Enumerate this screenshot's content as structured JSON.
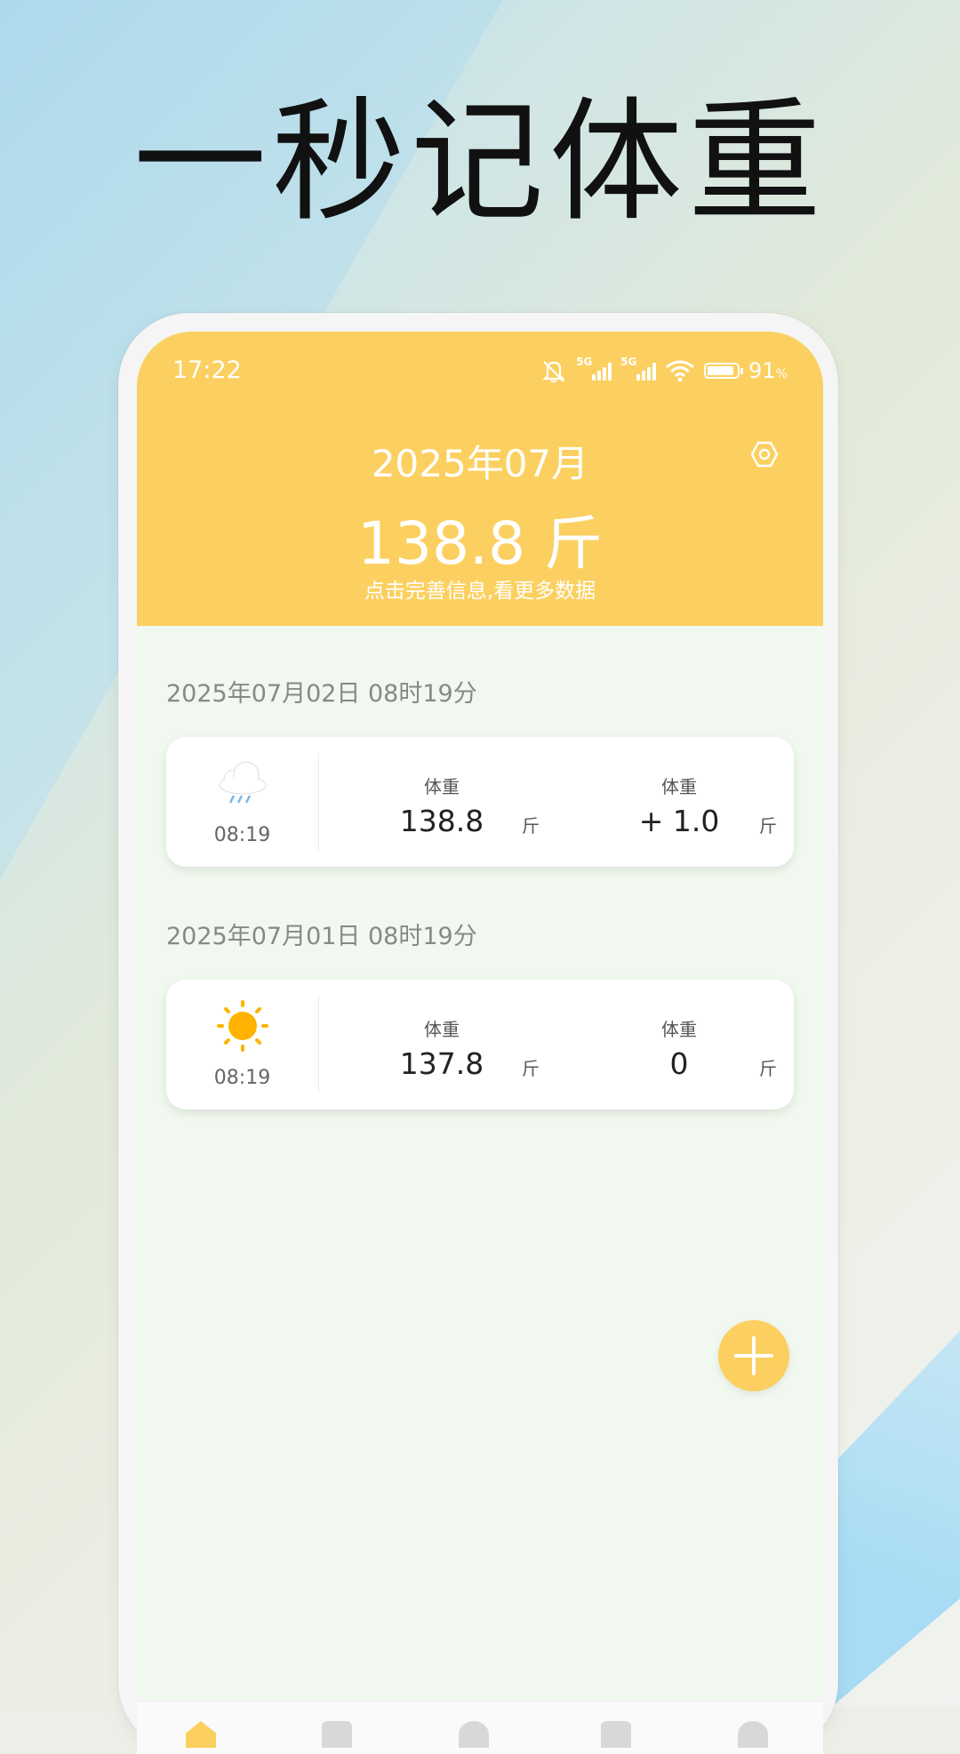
{
  "headline": "一秒记体重",
  "status_bar": {
    "time": "17:22",
    "signal_tag_1": "5G",
    "signal_tag_2": "5G",
    "battery_percent": "91",
    "battery_unit": "%",
    "battery_level": 0.91,
    "icons": [
      "mute-bell-icon",
      "signal-5g-icon",
      "signal-5g-icon",
      "wifi-icon",
      "battery-icon"
    ]
  },
  "header": {
    "month": "2025年07月",
    "weight": "138.8 斤",
    "hint": "点击完善信息,看更多数据",
    "settings_icon": "hexagon-gear-icon",
    "background_color": "#fcd060"
  },
  "records": [
    {
      "date": "2025年07月02日 08时19分",
      "weather_icon": "rain-cloud-icon",
      "time": "08:19",
      "weight_label": "体重",
      "weight_value": "138.8",
      "weight_unit": "斤",
      "change_label": "体重",
      "change_value": "+ 1.0",
      "change_unit": "斤"
    },
    {
      "date": "2025年07月01日 08时19分",
      "weather_icon": "sun-icon",
      "time": "08:19",
      "weight_label": "体重",
      "weight_value": "137.8",
      "weight_unit": "斤",
      "change_label": "体重",
      "change_value": "0",
      "change_unit": "斤"
    }
  ],
  "fab": {
    "icon": "plus-icon"
  },
  "tabbar": {
    "icons": [
      "home-icon",
      "calendar-icon",
      "chart-icon",
      "list-icon",
      "profile-icon"
    ]
  }
}
